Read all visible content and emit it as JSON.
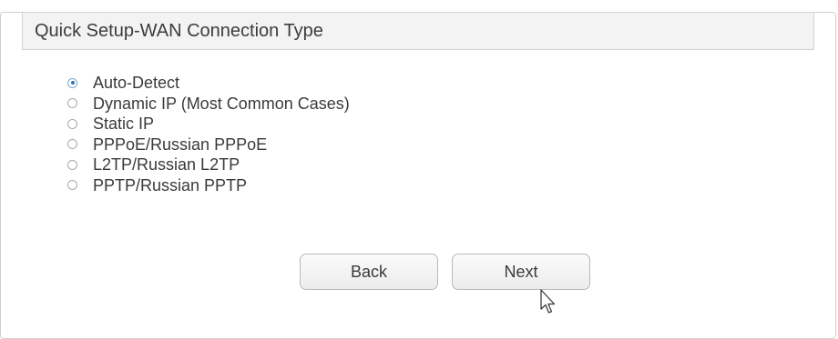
{
  "header": {
    "title": "Quick Setup-WAN Connection Type"
  },
  "options": [
    {
      "label": "Auto-Detect",
      "checked": true
    },
    {
      "label": "Dynamic IP (Most Common Cases)",
      "checked": false
    },
    {
      "label": "Static IP",
      "checked": false
    },
    {
      "label": "PPPoE/Russian PPPoE",
      "checked": false
    },
    {
      "label": "L2TP/Russian L2TP",
      "checked": false
    },
    {
      "label": "PPTP/Russian PPTP",
      "checked": false
    }
  ],
  "buttons": {
    "back_label": "Back",
    "next_label": "Next"
  },
  "colors": {
    "radio_selected": "#2a74b8",
    "header_background": "#f3f3f3"
  }
}
